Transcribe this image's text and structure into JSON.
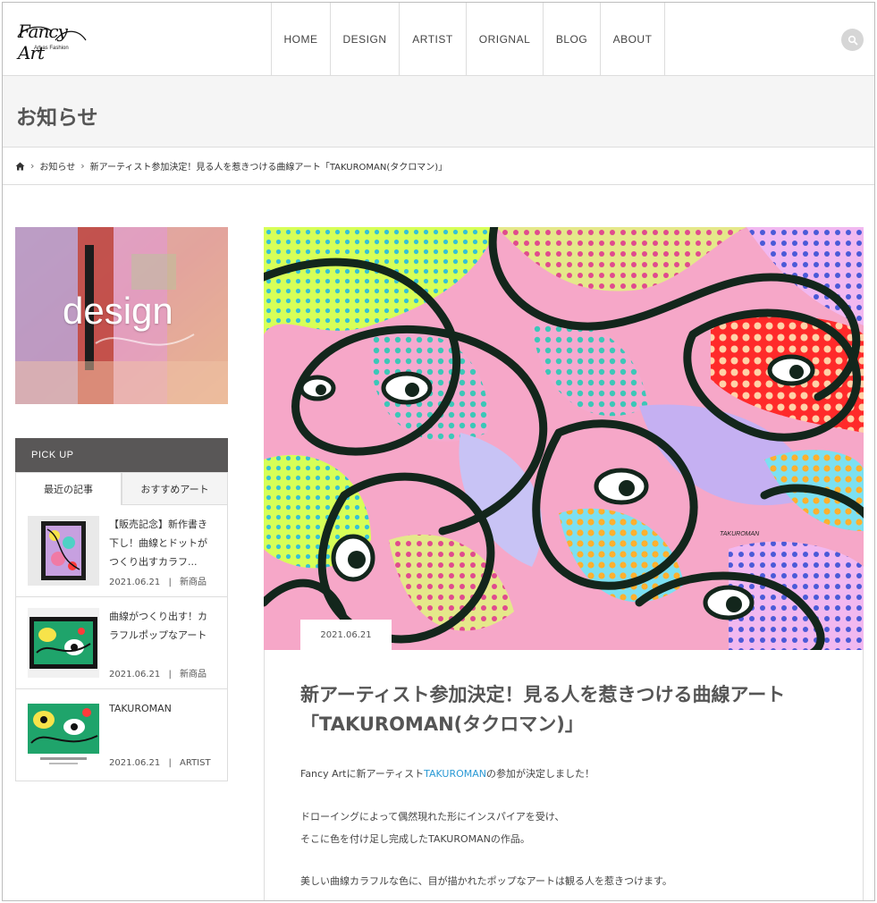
{
  "header": {
    "logo_script": "Fancy Art",
    "logo_sub": "Art as Fashion",
    "nav": [
      {
        "label": "HOME"
      },
      {
        "label": "DESIGN"
      },
      {
        "label": "ARTIST"
      },
      {
        "label": "ORIGNAL"
      },
      {
        "label": "BLOG"
      },
      {
        "label": "ABOUT"
      }
    ],
    "search_icon": "search-icon"
  },
  "page_title": "お知らせ",
  "breadcrumb": {
    "home_icon": "home-icon",
    "items": [
      "お知らせ",
      "新アーティスト参加決定！見る人を惹きつける曲線アート「TAKUROMAN(タクロマン)」"
    ]
  },
  "sidebar": {
    "banner_text": "design",
    "pickup_title": "PICK UP",
    "tabs": [
      "最近の記事",
      "おすすめアート"
    ],
    "posts": [
      {
        "title": "【販売記念】新作書き下し！曲線とドットがつくり出すカラフ...",
        "date": "2021.06.21",
        "category": "新商品"
      },
      {
        "title": "曲線がつくり出す！カラフルポップなアート",
        "date": "2021.06.21",
        "category": "新商品"
      },
      {
        "title": "TAKUROMAN",
        "date": "2021.06.21",
        "category": "ARTIST"
      }
    ],
    "meta_separator": "|"
  },
  "article": {
    "date": "2021.06.21",
    "title": "新アーティスト参加決定！見る人を惹きつける曲線アート「TAKUROMAN(タクロマン)」",
    "para1_pre": "Fancy Artに新アーティスト",
    "para1_link": "TAKUROMAN",
    "para1_post": "の参加が決定しました！",
    "para2_line1": "ドローイングによって偶然現れた形にインスパイアを受け、",
    "para2_line2": "そこに色を付け足し完成したTAKUROMANの作品。",
    "para3": "美しい曲線カラフルな色に、目が描かれたポップなアートは観る人を惹きつけます。",
    "artwork_signature": "TAKUROMAN"
  },
  "colors": {
    "accent_link": "#2b9ad5",
    "pickup_header": "#595757",
    "title_band": "#f5f5f5"
  }
}
